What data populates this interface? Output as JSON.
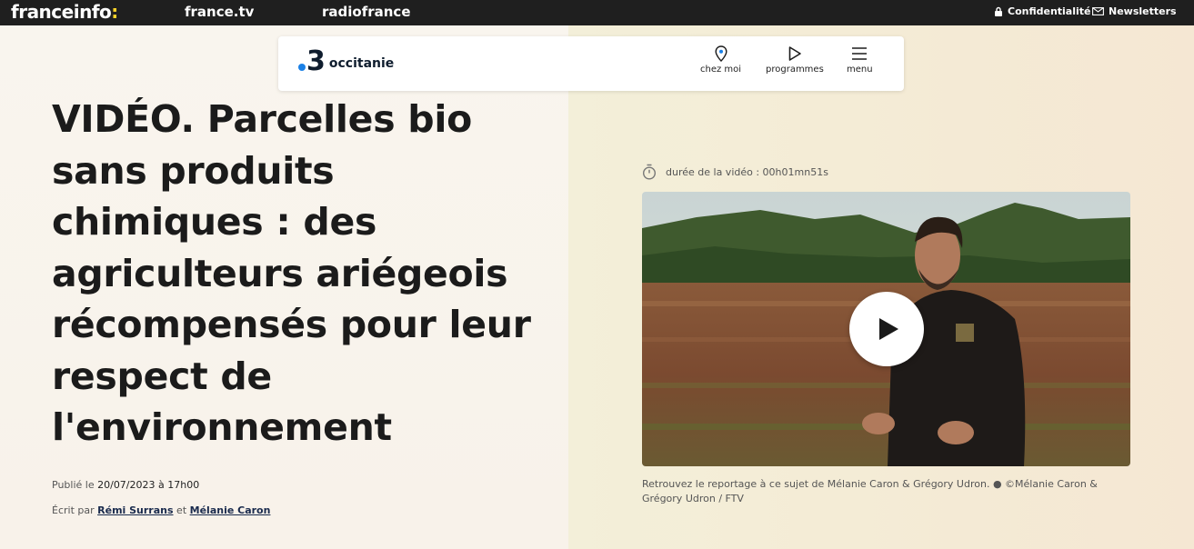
{
  "topbar": {
    "brand": "franceinfo",
    "brand_colon": ":",
    "links": [
      "france.tv",
      "radiofrance"
    ],
    "privacy_label": "Confidentialité",
    "newsletters_label": "Newsletters"
  },
  "header": {
    "logo_number": "3",
    "region": "occitanie",
    "buttons": {
      "chez_moi": "chez moi",
      "programmes": "programmes",
      "menu": "menu"
    }
  },
  "article": {
    "headline": "VIDÉO. Parcelles bio sans produits chimiques : des agriculteurs ariégeois récompensés pour leur respect de l'environnement",
    "published_prefix": "Publié le",
    "published_date": "20/07/2023 à 17h00",
    "written_prefix": "Écrit par",
    "authors": [
      "Rémi Surrans",
      "Mélanie Caron"
    ],
    "authors_joiner": "et"
  },
  "video": {
    "duration_label": "durée de la vidéo : 00h01mn51s",
    "caption": "Retrouvez le reportage à ce sujet de Mélanie Caron & Grégory Udron. ● ©Mélanie Caron & Grégory Udron / FTV"
  },
  "icons": {
    "lock": "lock-icon",
    "mail": "mail-icon",
    "location": "location-pin-icon",
    "play": "play-icon",
    "menu": "hamburger-icon",
    "timer": "timer-icon"
  },
  "colors": {
    "topbar_bg": "#1f1f1f",
    "brand_accent": "#ffd42a",
    "logo_dot": "#1a80e6",
    "author_link": "#1a2b4d"
  }
}
